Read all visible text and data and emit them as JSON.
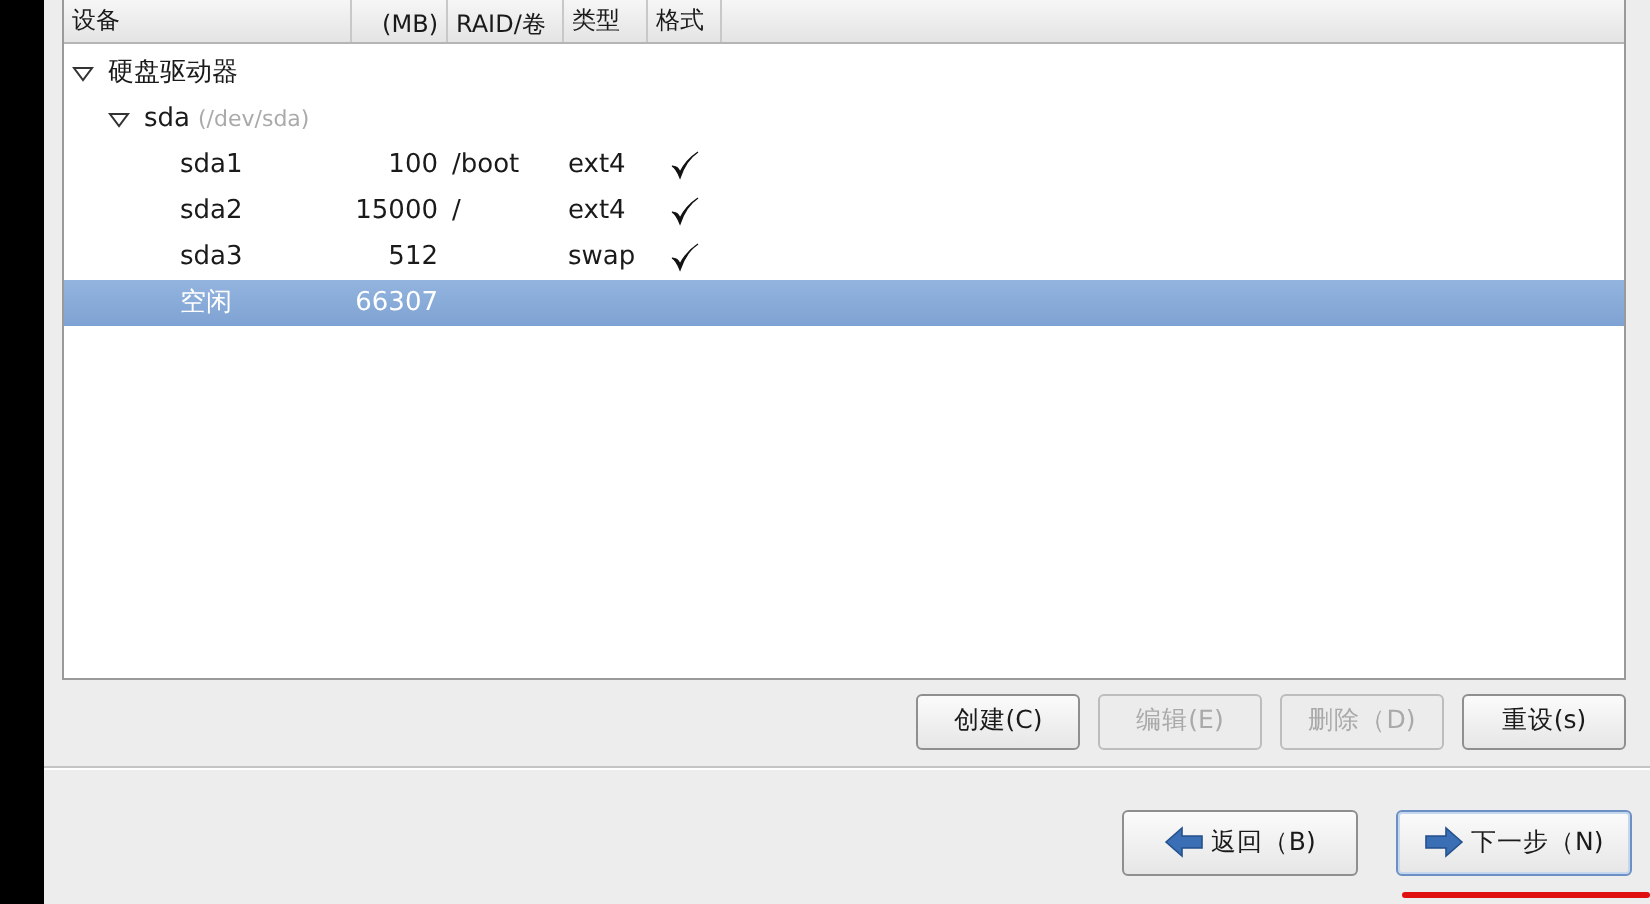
{
  "table": {
    "columns": [
      "设备",
      "(MB)",
      "RAID/卷",
      "类型",
      "格式"
    ],
    "rows": [
      {
        "device": "硬盘驱动器",
        "expanded": true,
        "selected": false,
        "children": [
          {
            "device": "sda",
            "path": "(/dev/sda)",
            "expanded": true,
            "selected": false,
            "children": [
              {
                "device": "sda1",
                "size": "100",
                "mount": "/boot",
                "type": "ext4",
                "format": true,
                "selected": false
              },
              {
                "device": "sda2",
                "size": "15000",
                "mount": "/",
                "type": "ext4",
                "format": true,
                "selected": false
              },
              {
                "device": "sda3",
                "size": "512",
                "type": "swap",
                "format": true,
                "selected": false
              },
              {
                "device": "空闲",
                "size": "66307",
                "selected": true
              }
            ]
          }
        ]
      }
    ]
  },
  "actions": [
    {
      "label": "创建(C)",
      "disabled": false
    },
    {
      "label": "编辑(E)",
      "disabled": true
    },
    {
      "label": "删除（D)",
      "disabled": true
    },
    {
      "label": "重设(s)",
      "disabled": false
    }
  ],
  "navigation": [
    {
      "label": "返回（B)",
      "kind": "back",
      "default": false
    },
    {
      "label": "下一步（N)",
      "kind": "next",
      "default": true
    }
  ]
}
